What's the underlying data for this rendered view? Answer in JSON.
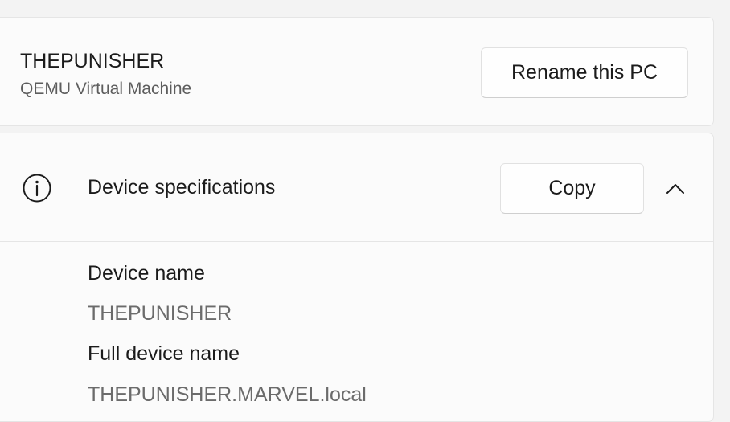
{
  "device": {
    "name": "THEPUNISHER",
    "model": "QEMU Virtual Machine",
    "rename_label": "Rename this PC"
  },
  "specs": {
    "title": "Device specifications",
    "copy_label": "Copy",
    "icons": {
      "info": "info-icon",
      "collapse": "chevron-up-icon"
    },
    "items": [
      {
        "label": "Device name",
        "value": "THEPUNISHER"
      },
      {
        "label": "Full device name",
        "value": "THEPUNISHER.MARVEL.local"
      }
    ]
  }
}
